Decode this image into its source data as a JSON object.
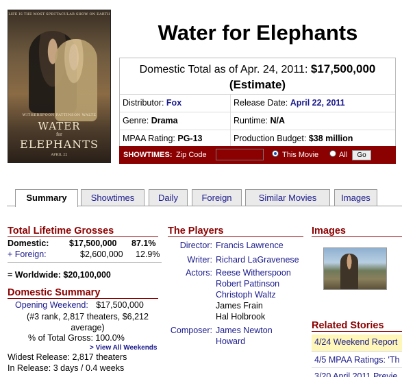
{
  "poster": {
    "tagline": "LIFE IS THE MOST SPECTACULAR SHOW ON EARTH",
    "cast": "WITHERSPOON  PATTINSON  WALTZ",
    "title_top": "WATER",
    "title_mid": "for",
    "title_bottom": "ELEPHANTS",
    "date": "APRIL 22"
  },
  "movie": {
    "title": "Water for Elephants",
    "total_label": "Domestic Total as of Apr. 24, 2011:",
    "total_value": "$17,500,000",
    "total_note": "(Estimate)",
    "distributor_label": "Distributor:",
    "distributor": "Fox",
    "release_label": "Release Date:",
    "release": "April 22, 2011",
    "genre_label": "Genre:",
    "genre": "Drama",
    "runtime_label": "Runtime:",
    "runtime": "N/A",
    "rating_label": "MPAA Rating:",
    "rating": "PG-13",
    "budget_label": "Production Budget:",
    "budget": "$38 million"
  },
  "showtimes": {
    "label": "SHOWTIMES:",
    "zip_label": "Zip Code",
    "opt_this": "This Movie",
    "opt_all": "All",
    "go": "Go"
  },
  "tabs": [
    "Summary",
    "Showtimes",
    "Daily",
    "Foreign",
    "Similar Movies",
    "Images"
  ],
  "grosses": {
    "heading": "Total Lifetime Grosses",
    "domestic_label": "Domestic:",
    "domestic_value": "$17,500,000",
    "domestic_pct": "87.1%",
    "foreign_label": "+ Foreign:",
    "foreign_value": "$2,600,000",
    "foreign_pct": "12.9%",
    "worldwide": "= Worldwide: $20,100,000"
  },
  "domestic_summary": {
    "heading": "Domestic Summary",
    "opening_label": "Opening Weekend:",
    "opening_value": "$17,500,000",
    "opening_detail": "(#3 rank, 2,817 theaters, $6,212 average)",
    "pct": "% of Total Gross: 100.0%",
    "view_all": "> View All Weekends",
    "widest": "Widest Release: 2,817 theaters",
    "in_release": "In Release: 3 days / 0.4 weeks"
  },
  "players": {
    "heading": "The Players",
    "director_label": "Director:",
    "director": "Francis Lawrence",
    "writer_label": "Writer:",
    "writer": "Richard LaGravenese",
    "actors_label": "Actors:",
    "actors": [
      "Reese Witherspoon",
      "Robert Pattinson",
      "Christoph Waltz",
      "James Frain",
      "Hal Holbrook"
    ],
    "composer_label": "Composer:",
    "composer_1": "James Newton",
    "composer_2": "Howard"
  },
  "images": {
    "heading": "Images"
  },
  "related": {
    "heading": "Related Stories",
    "items": [
      "4/24 Weekend Report",
      "4/5 MPAA Ratings: 'Th",
      "3/20 April 2011 Previe"
    ]
  }
}
